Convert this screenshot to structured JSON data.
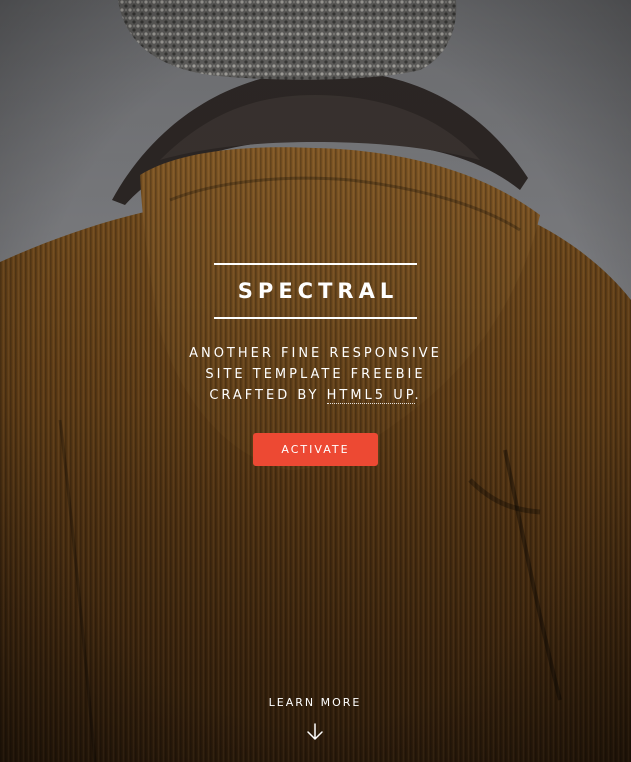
{
  "header": {
    "title": "SPECTRAL",
    "tagline_lines": [
      "ANOTHER FINE RESPONSIVE",
      "SITE TEMPLATE FREEBIE"
    ],
    "tagline_prefix": "CRAFTED BY",
    "tagline_link": "HTML5 UP",
    "tagline_suffix": "."
  },
  "actions": {
    "activate_label": "ACTIVATE"
  },
  "scroll": {
    "label": "LEARN MORE",
    "icon": "arrow-down-icon"
  },
  "colors": {
    "accent": "#ed4933",
    "text": "#ffffff",
    "sky": "#8b8c90",
    "jacket": "#6a4418"
  }
}
